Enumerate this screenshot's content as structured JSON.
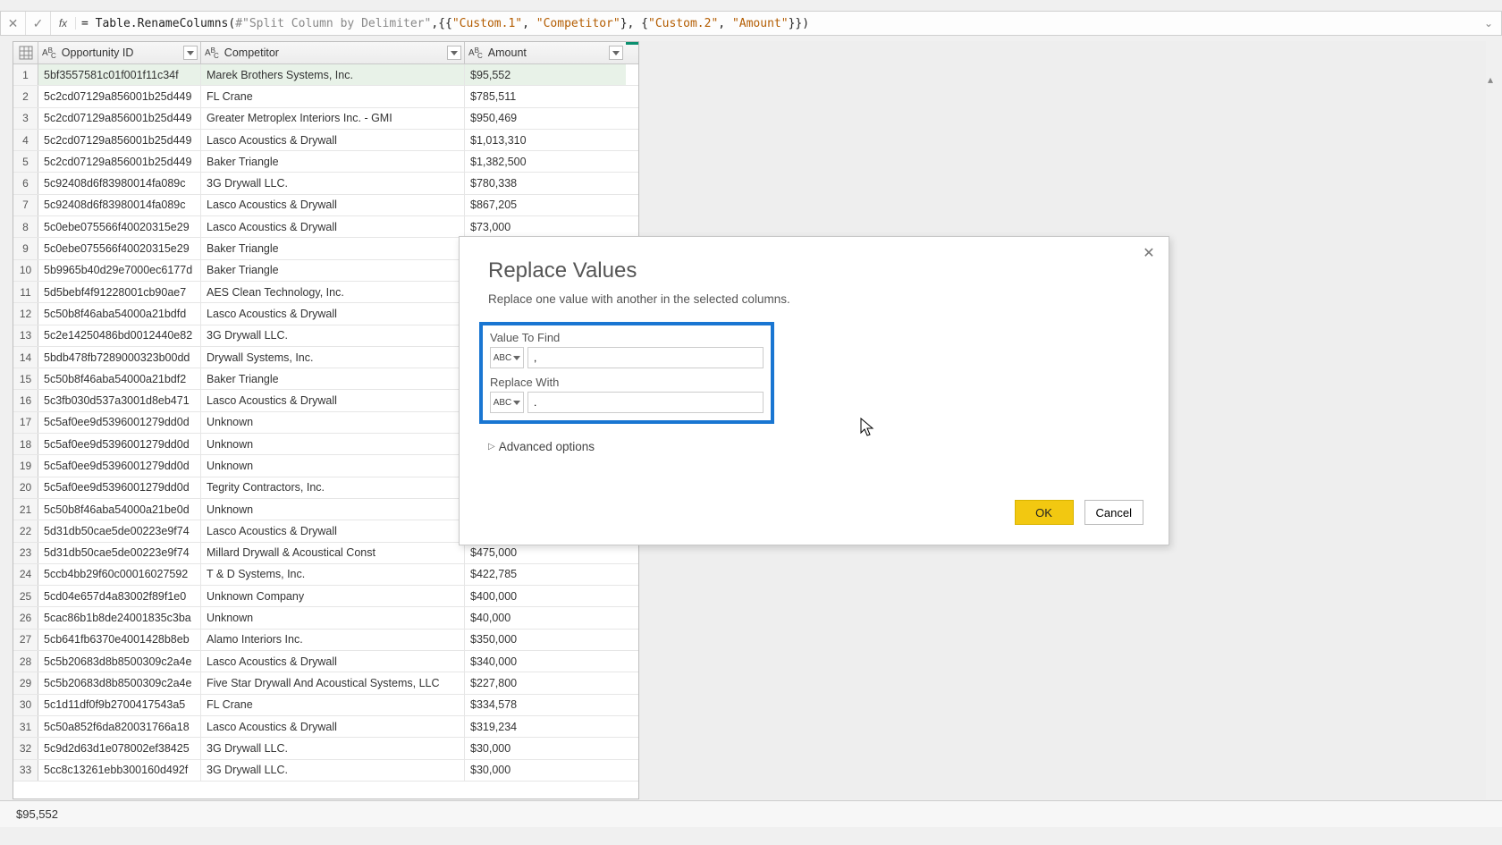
{
  "formula_bar": {
    "cancel_glyph": "✕",
    "accept_glyph": "✓",
    "fx_label": "fx",
    "formula_prefix": "= Table.RenameColumns(",
    "formula_step": "#\"Split Column by Delimiter\"",
    "formula_mid1": ",{{",
    "formula_s1a": "\"Custom.1\"",
    "formula_comma1": ", ",
    "formula_s1b": "\"Competitor\"",
    "formula_mid2": "}, {",
    "formula_s2a": "\"Custom.2\"",
    "formula_comma2": ", ",
    "formula_s2b": "\"Amount\"",
    "formula_suffix": "}})",
    "expand_glyph": "⌄"
  },
  "columns": {
    "opportunity": "Opportunity ID",
    "competitor": "Competitor",
    "amount": "Amount"
  },
  "rows": [
    {
      "n": "1",
      "id": "5bf3557581c01f001f11c34f",
      "comp": "Marek Brothers Systems, Inc.",
      "amt": "$95,552"
    },
    {
      "n": "2",
      "id": "5c2cd07129a856001b25d449",
      "comp": "FL Crane",
      "amt": "$785,511"
    },
    {
      "n": "3",
      "id": "5c2cd07129a856001b25d449",
      "comp": "Greater Metroplex Interiors  Inc. - GMI",
      "amt": "$950,469"
    },
    {
      "n": "4",
      "id": "5c2cd07129a856001b25d449",
      "comp": "Lasco Acoustics & Drywall",
      "amt": "$1,013,310"
    },
    {
      "n": "5",
      "id": "5c2cd07129a856001b25d449",
      "comp": "Baker Triangle",
      "amt": "$1,382,500"
    },
    {
      "n": "6",
      "id": "5c92408d6f83980014fa089c",
      "comp": "3G Drywall LLC.",
      "amt": "$780,338"
    },
    {
      "n": "7",
      "id": "5c92408d6f83980014fa089c",
      "comp": "Lasco Acoustics & Drywall",
      "amt": "$867,205"
    },
    {
      "n": "8",
      "id": "5c0ebe075566f40020315e29",
      "comp": "Lasco Acoustics & Drywall",
      "amt": "$73,000"
    },
    {
      "n": "9",
      "id": "5c0ebe075566f40020315e29",
      "comp": "Baker Triangle",
      "amt": ""
    },
    {
      "n": "10",
      "id": "5b9965b40d29e7000ec6177d",
      "comp": "Baker Triangle",
      "amt": ""
    },
    {
      "n": "11",
      "id": "5d5bebf4f91228001cb90ae7",
      "comp": "AES Clean Technology, Inc.",
      "amt": ""
    },
    {
      "n": "12",
      "id": "5c50b8f46aba54000a21bdfd",
      "comp": "Lasco Acoustics & Drywall",
      "amt": ""
    },
    {
      "n": "13",
      "id": "5c2e14250486bd0012440e82",
      "comp": "3G Drywall LLC.",
      "amt": ""
    },
    {
      "n": "14",
      "id": "5bdb478fb7289000323b00dd",
      "comp": "Drywall Systems, Inc.",
      "amt": ""
    },
    {
      "n": "15",
      "id": "5c50b8f46aba54000a21bdf2",
      "comp": "Baker Triangle",
      "amt": ""
    },
    {
      "n": "16",
      "id": "5c3fb030d537a3001d8eb471",
      "comp": "Lasco Acoustics & Drywall",
      "amt": ""
    },
    {
      "n": "17",
      "id": "5c5af0ee9d5396001279dd0d",
      "comp": "Unknown",
      "amt": ""
    },
    {
      "n": "18",
      "id": "5c5af0ee9d5396001279dd0d",
      "comp": "Unknown",
      "amt": ""
    },
    {
      "n": "19",
      "id": "5c5af0ee9d5396001279dd0d",
      "comp": "Unknown",
      "amt": ""
    },
    {
      "n": "20",
      "id": "5c5af0ee9d5396001279dd0d",
      "comp": "Tegrity Contractors, Inc.",
      "amt": ""
    },
    {
      "n": "21",
      "id": "5c50b8f46aba54000a21be0d",
      "comp": "Unknown",
      "amt": ""
    },
    {
      "n": "22",
      "id": "5d31db50cae5de00223e9f74",
      "comp": "Lasco Acoustics & Drywall",
      "amt": ""
    },
    {
      "n": "23",
      "id": "5d31db50cae5de00223e9f74",
      "comp": "Millard Drywall & Acoustical Const",
      "amt": "$475,000"
    },
    {
      "n": "24",
      "id": "5ccb4bb29f60c00016027592",
      "comp": "T & D Systems, Inc.",
      "amt": "$422,785"
    },
    {
      "n": "25",
      "id": "5cd04e657d4a83002f89f1e0",
      "comp": "Unknown Company",
      "amt": "$400,000"
    },
    {
      "n": "26",
      "id": "5cac86b1b8de24001835c3ba",
      "comp": "Unknown",
      "amt": "$40,000"
    },
    {
      "n": "27",
      "id": "5cb641fb6370e4001428b8eb",
      "comp": "Alamo Interiors Inc.",
      "amt": "$350,000"
    },
    {
      "n": "28",
      "id": "5c5b20683d8b8500309c2a4e",
      "comp": "Lasco Acoustics & Drywall",
      "amt": "$340,000"
    },
    {
      "n": "29",
      "id": "5c5b20683d8b8500309c2a4e",
      "comp": "Five Star Drywall And Acoustical Systems, LLC",
      "amt": "$227,800"
    },
    {
      "n": "30",
      "id": "5c1d11df0f9b2700417543a5",
      "comp": "FL Crane",
      "amt": "$334,578"
    },
    {
      "n": "31",
      "id": "5c50a852f6da820031766a18",
      "comp": "Lasco Acoustics & Drywall",
      "amt": "$319,234"
    },
    {
      "n": "32",
      "id": "5c9d2d63d1e078002ef38425",
      "comp": "3G Drywall LLC.",
      "amt": "$30,000"
    },
    {
      "n": "33",
      "id": "5cc8c13261ebb300160d492f",
      "comp": "3G Drywall LLC.",
      "amt": "$30,000"
    }
  ],
  "status": {
    "text": "$95,552"
  },
  "dialog": {
    "title": "Replace Values",
    "subtitle": "Replace one value with another in the selected columns.",
    "find_label": "Value To Find",
    "find_value": ",",
    "replace_label": "Replace With",
    "replace_value": ".",
    "advanced": "Advanced options",
    "ok": "OK",
    "cancel": "Cancel"
  },
  "scroll": {
    "up": "▴",
    "down": "▾"
  }
}
